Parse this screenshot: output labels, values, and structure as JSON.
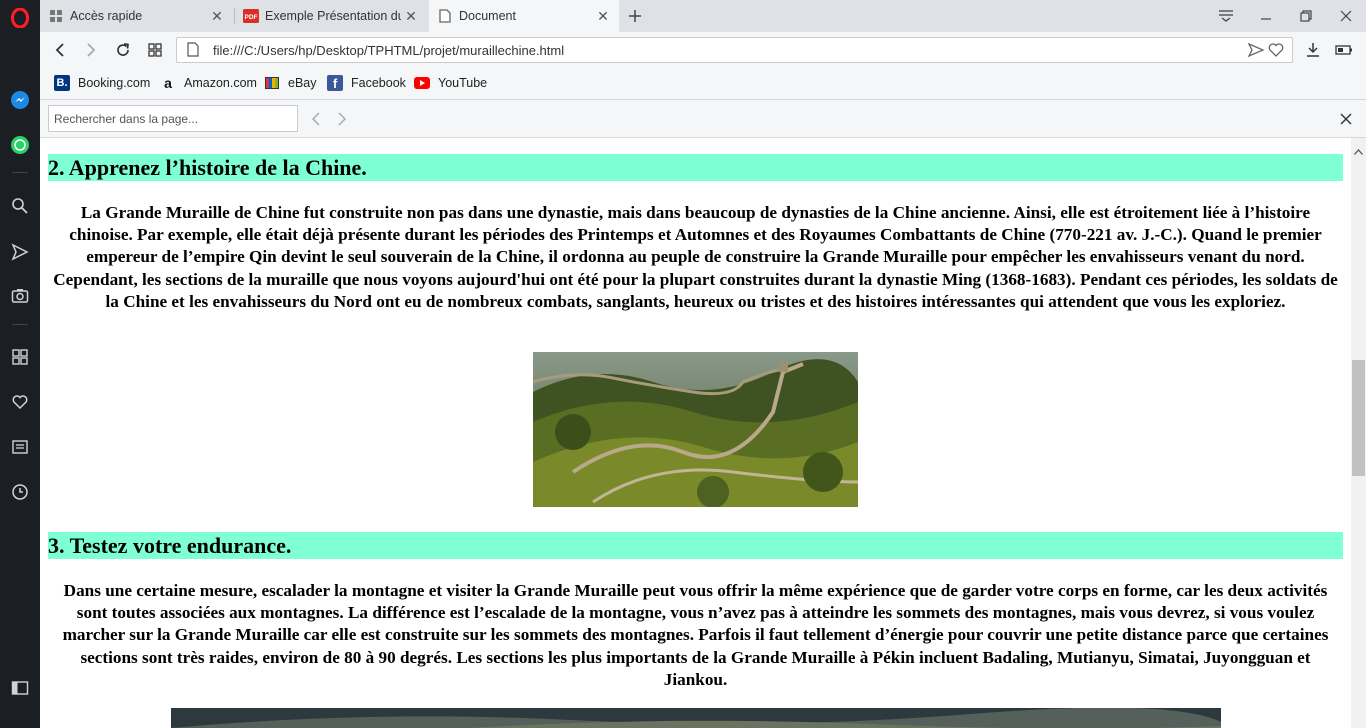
{
  "browser": {
    "tabs": [
      {
        "title": "Accès rapide",
        "icon": "speed-dial-icon",
        "active": false
      },
      {
        "title": "Exemple Présentation du p",
        "icon": "pdf-icon",
        "active": false
      },
      {
        "title": "Document",
        "icon": "document-icon",
        "active": true
      }
    ],
    "url": "file:///C:/Users/hp/Desktop/TPHTML/projet/muraillechine.html",
    "bookmarks": [
      {
        "label": "Booking.com",
        "icon": "booking-icon"
      },
      {
        "label": "Amazon.com",
        "icon": "amazon-icon"
      },
      {
        "label": "eBay",
        "icon": "ebay-icon"
      },
      {
        "label": "Facebook",
        "icon": "facebook-icon"
      },
      {
        "label": "YouTube",
        "icon": "youtube-icon"
      }
    ],
    "find_placeholder": "Rechercher dans la page..."
  },
  "page": {
    "section2": {
      "heading": "2. Apprenez l’histoire de la Chine.",
      "text": "La Grande Muraille de Chine fut construite non pas dans une dynastie, mais dans beaucoup de dynasties de la Chine ancienne. Ainsi, elle est étroitement liée à l’histoire chinoise. Par exemple, elle était déjà présente durant les périodes des Printemps et Automnes et des Royaumes Combattants de Chine (770-221 av. J.-C.). Quand le premier empereur de l’empire Qin devint le seul souverain de la Chine, il ordonna au peuple de construire la Grande Muraille pour empêcher les envahisseurs venant du nord. Cependant, les sections de la muraille que nous voyons aujourd'hui ont été pour la plupart construites durant la dynastie Ming (1368-1683). Pendant ces périodes, les soldats de la Chine et les envahisseurs du Nord ont eu de nombreux combats, sanglants, heureux ou tristes et des histoires intéressantes qui attendent que vous les exploriez."
    },
    "section3": {
      "heading": "3. Testez votre endurance.",
      "text": "Dans une certaine mesure, escalader la montagne et visiter la Grande Muraille peut vous offrir la même expérience que de garder votre corps en forme, car les deux activités sont toutes associées aux montagnes. La différence est l’escalade de la montagne, vous n’avez pas à atteindre les sommets des montagnes, mais vous devrez, si vous voulez marcher sur la Grande Muraille car elle est construite sur les sommets des montagnes. Parfois il faut tellement d’énergie pour couvrir une petite distance parce que certaines sections sont très raides, environ de 80 à 90 degrés. Les sections les plus importants de la Grande Muraille à Pékin incluent Badaling, Mutianyu, Simatai, Juyongguan et Jiankou."
    }
  },
  "colors": {
    "heading_bg": "#7fffd4",
    "sidebar_bg": "#1b1e22",
    "opera_red": "#ff1b2d"
  }
}
